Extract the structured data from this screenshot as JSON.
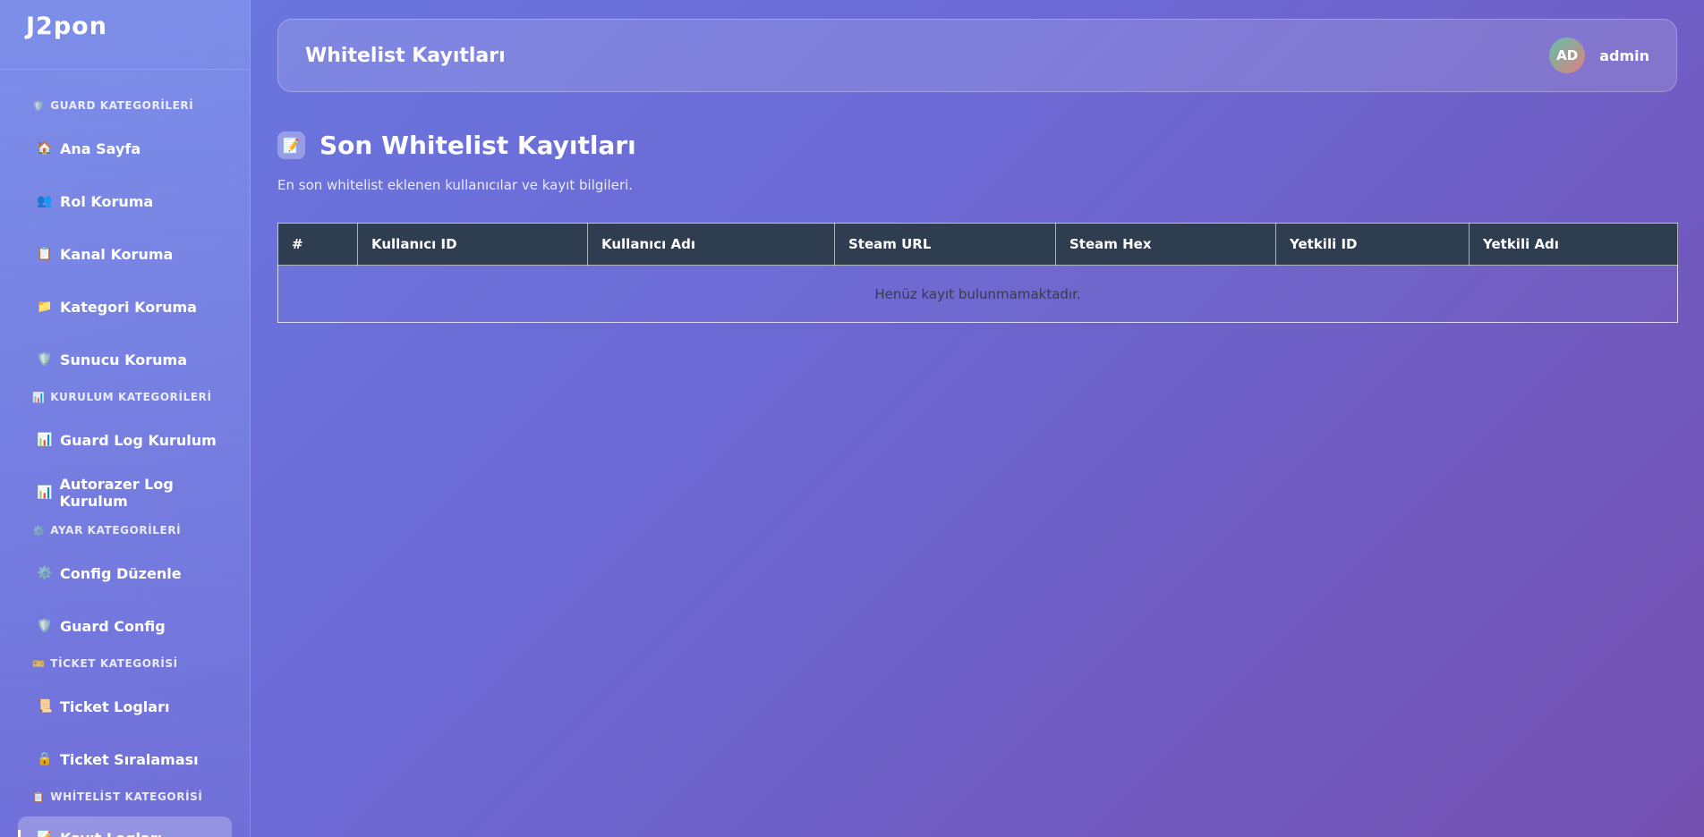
{
  "brand": {
    "name": "J2pon"
  },
  "sidebar": {
    "sections": [
      {
        "label": "GUARD KATEGORİLERİ",
        "icon": "🛡️"
      },
      {
        "label": "KURULUM KATEGORİLERİ",
        "icon": "📊"
      },
      {
        "label": "AYAR KATEGORİLERİ",
        "icon": "⚙️"
      },
      {
        "label": "TİCKET KATEGORİSİ",
        "icon": "🎫"
      },
      {
        "label": "WHİTELİST KATEGORİSİ",
        "icon": "📋"
      }
    ],
    "items": [
      {
        "label": "Ana Sayfa",
        "icon": "🏠"
      },
      {
        "label": "Rol Koruma",
        "icon": "👥"
      },
      {
        "label": "Kanal Koruma",
        "icon": "📋"
      },
      {
        "label": "Kategori Koruma",
        "icon": "📁"
      },
      {
        "label": "Sunucu Koruma",
        "icon": "🛡️"
      },
      {
        "label": "Guard Log Kurulum",
        "icon": "📊"
      },
      {
        "label": "Autorazer Log Kurulum",
        "icon": "📊"
      },
      {
        "label": "Config Düzenle",
        "icon": "⚙️"
      },
      {
        "label": "Guard Config",
        "icon": "🛡️"
      },
      {
        "label": "Ticket Logları",
        "icon": "📜"
      },
      {
        "label": "Ticket Sıralaması",
        "icon": "🔒"
      },
      {
        "label": "Kayıt Logları",
        "icon": "📝"
      }
    ]
  },
  "header": {
    "title": "Whitelist Kayıtları",
    "user": {
      "initials": "AD",
      "name": "admin"
    }
  },
  "main": {
    "heading": "Son Whitelist Kayıtları",
    "heading_icon": "📝",
    "description": "En son whitelist eklenen kullanıcılar ve kayıt bilgileri.",
    "table": {
      "columns": [
        "#",
        "Kullanıcı ID",
        "Kullanıcı Adı",
        "Steam URL",
        "Steam Hex",
        "Yetkili ID",
        "Yetkili Adı"
      ],
      "empty_message": "Henüz kayıt bulunmamaktadır."
    }
  }
}
